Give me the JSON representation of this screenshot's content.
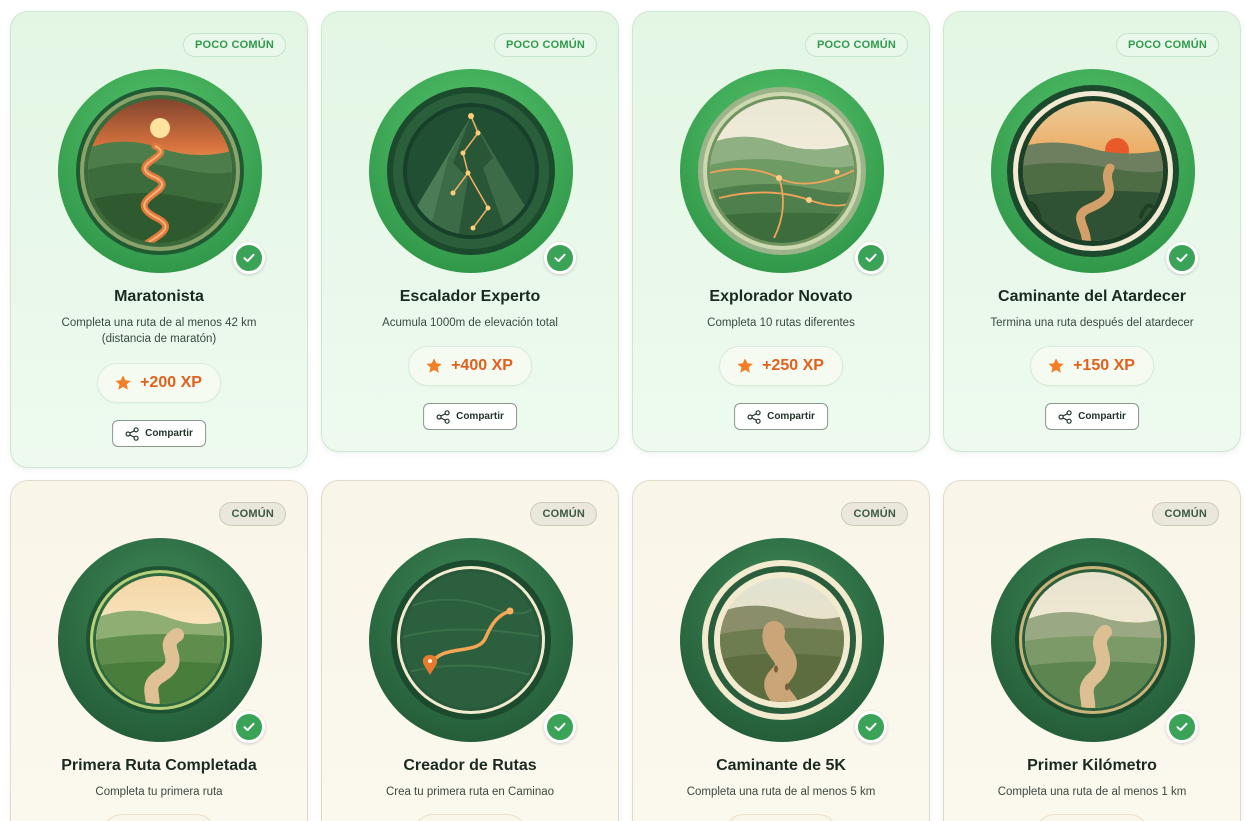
{
  "cards": [
    {
      "rarity": "POCO COMÚN",
      "title": "Maratonista",
      "description": "Completa una ruta de al menos 42 km (distancia de maratón)",
      "xp": "+200 XP",
      "share": "Compartir"
    },
    {
      "rarity": "POCO COMÚN",
      "title": "Escalador Experto",
      "description": "Acumula 1000m de elevación total",
      "xp": "+400 XP",
      "share": "Compartir"
    },
    {
      "rarity": "POCO COMÚN",
      "title": "Explorador Novato",
      "description": "Completa 10 rutas diferentes",
      "xp": "+250 XP",
      "share": "Compartir"
    },
    {
      "rarity": "POCO COMÚN",
      "title": "Caminante del Atardecer",
      "description": "Termina una ruta después del atardecer",
      "xp": "+150 XP",
      "share": "Compartir"
    },
    {
      "rarity": "COMÚN",
      "title": "Primera Ruta Completada",
      "description": "Completa tu primera ruta"
    },
    {
      "rarity": "COMÚN",
      "title": "Creador de Rutas",
      "description": "Crea tu primera ruta en Caminao"
    },
    {
      "rarity": "COMÚN",
      "title": "Caminante de 5K",
      "description": "Completa una ruta de al menos 5 km"
    },
    {
      "rarity": "COMÚN",
      "title": "Primer Kilómetro",
      "description": "Completa una ruta de al menos 1 km"
    }
  ],
  "icons": {
    "star": "star-icon",
    "share": "share-icon",
    "check": "check-icon",
    "medals": [
      "marathon-trail-medal",
      "mountain-climb-medal",
      "explorer-paths-medal",
      "sunset-walker-medal",
      "first-route-medal",
      "route-creator-medal",
      "five-k-medal",
      "first-kilometer-medal"
    ]
  },
  "colors": {
    "uncommon_ring": "#3ea95a",
    "common_ring": "#2f6e45",
    "check": "#3aa358",
    "xp_text": "#e0611e",
    "star": "#f07f26"
  }
}
